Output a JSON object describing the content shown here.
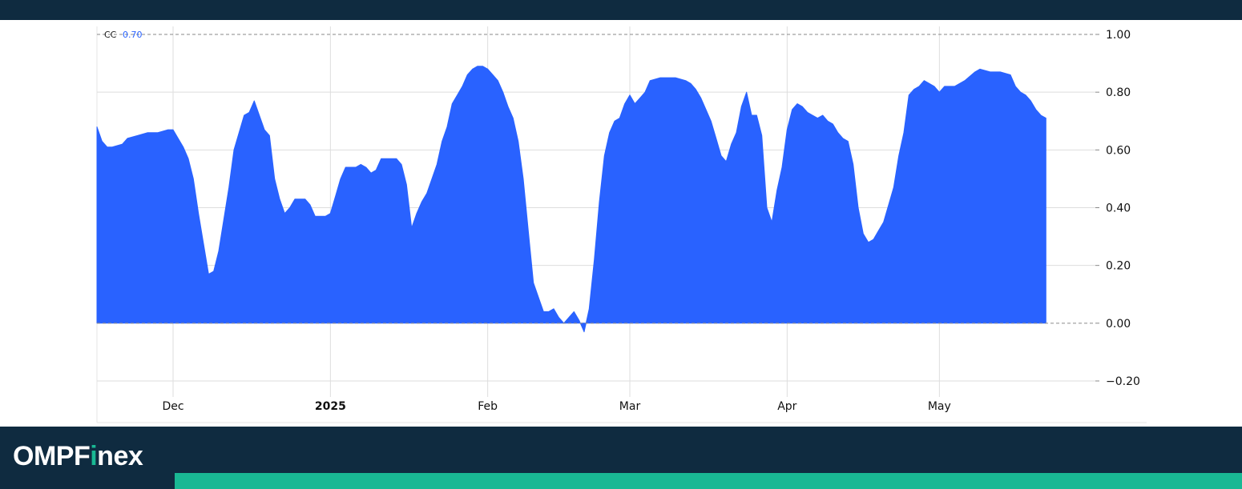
{
  "brand": {
    "logo_prefix": "OMPF",
    "logo_accent": "i",
    "logo_suffix": "nex",
    "accent_color": "#19b894",
    "bar_color": "#0f2b40"
  },
  "chart_data": {
    "type": "area",
    "series_label": "CC",
    "last_value_label": "0.70",
    "fill_color": "#2962ff",
    "ylim": [
      -0.2,
      1.0
    ],
    "y_ticks": [
      {
        "value": 1.0,
        "label": "1.00"
      },
      {
        "value": 0.8,
        "label": "0.80"
      },
      {
        "value": 0.6,
        "label": "0.60"
      },
      {
        "value": 0.4,
        "label": "0.40"
      },
      {
        "value": 0.2,
        "label": "0.20"
      },
      {
        "value": 0.0,
        "label": "0.00"
      },
      {
        "value": -0.2,
        "label": "−0.20"
      }
    ],
    "x_range": [
      "2024-11-16",
      "2025-05-30"
    ],
    "x_ticks": [
      {
        "date": "2024-12-01",
        "label": "Dec",
        "bold": false
      },
      {
        "date": "2025-01-01",
        "label": "2025",
        "bold": true
      },
      {
        "date": "2025-02-01",
        "label": "Feb",
        "bold": false
      },
      {
        "date": "2025-03-01",
        "label": "Mar",
        "bold": false
      },
      {
        "date": "2025-04-01",
        "label": "Apr",
        "bold": false
      },
      {
        "date": "2025-05-01",
        "label": "May",
        "bold": false
      }
    ],
    "grid": true,
    "points": [
      [
        "2024-11-16",
        0.68
      ],
      [
        "2024-11-17",
        0.63
      ],
      [
        "2024-11-18",
        0.61
      ],
      [
        "2024-11-19",
        0.61
      ],
      [
        "2024-11-21",
        0.62
      ],
      [
        "2024-11-22",
        0.64
      ],
      [
        "2024-11-24",
        0.65
      ],
      [
        "2024-11-26",
        0.66
      ],
      [
        "2024-11-28",
        0.66
      ],
      [
        "2024-11-30",
        0.67
      ],
      [
        "2024-12-01",
        0.67
      ],
      [
        "2024-12-02",
        0.64
      ],
      [
        "2024-12-03",
        0.61
      ],
      [
        "2024-12-04",
        0.57
      ],
      [
        "2024-12-05",
        0.5
      ],
      [
        "2024-12-06",
        0.38
      ],
      [
        "2024-12-08",
        0.17
      ],
      [
        "2024-12-09",
        0.18
      ],
      [
        "2024-12-10",
        0.25
      ],
      [
        "2024-12-12",
        0.47
      ],
      [
        "2024-12-13",
        0.6
      ],
      [
        "2024-12-15",
        0.72
      ],
      [
        "2024-12-16",
        0.73
      ],
      [
        "2024-12-17",
        0.77
      ],
      [
        "2024-12-19",
        0.67
      ],
      [
        "2024-12-20",
        0.65
      ],
      [
        "2024-12-21",
        0.5
      ],
      [
        "2024-12-22",
        0.43
      ],
      [
        "2024-12-23",
        0.38
      ],
      [
        "2024-12-24",
        0.4
      ],
      [
        "2024-12-25",
        0.43
      ],
      [
        "2024-12-27",
        0.43
      ],
      [
        "2024-12-28",
        0.41
      ],
      [
        "2024-12-29",
        0.37
      ],
      [
        "2024-12-31",
        0.37
      ],
      [
        "2025-01-01",
        0.38
      ],
      [
        "2025-01-02",
        0.44
      ],
      [
        "2025-01-03",
        0.5
      ],
      [
        "2025-01-04",
        0.54
      ],
      [
        "2025-01-06",
        0.54
      ],
      [
        "2025-01-07",
        0.55
      ],
      [
        "2025-01-08",
        0.54
      ],
      [
        "2025-01-09",
        0.52
      ],
      [
        "2025-01-10",
        0.53
      ],
      [
        "2025-01-11",
        0.57
      ],
      [
        "2025-01-12",
        0.57
      ],
      [
        "2025-01-14",
        0.57
      ],
      [
        "2025-01-15",
        0.55
      ],
      [
        "2025-01-16",
        0.48
      ],
      [
        "2025-01-17",
        0.33
      ],
      [
        "2025-01-18",
        0.38
      ],
      [
        "2025-01-19",
        0.42
      ],
      [
        "2025-01-20",
        0.45
      ],
      [
        "2025-01-22",
        0.55
      ],
      [
        "2025-01-23",
        0.63
      ],
      [
        "2025-01-24",
        0.68
      ],
      [
        "2025-01-25",
        0.76
      ],
      [
        "2025-01-26",
        0.79
      ],
      [
        "2025-01-27",
        0.82
      ],
      [
        "2025-01-28",
        0.86
      ],
      [
        "2025-01-29",
        0.88
      ],
      [
        "2025-01-30",
        0.89
      ],
      [
        "2025-01-31",
        0.89
      ],
      [
        "2025-02-01",
        0.88
      ],
      [
        "2025-02-02",
        0.86
      ],
      [
        "2025-02-03",
        0.84
      ],
      [
        "2025-02-04",
        0.8
      ],
      [
        "2025-02-05",
        0.75
      ],
      [
        "2025-02-06",
        0.71
      ],
      [
        "2025-02-07",
        0.63
      ],
      [
        "2025-02-08",
        0.5
      ],
      [
        "2025-02-09",
        0.32
      ],
      [
        "2025-02-10",
        0.14
      ],
      [
        "2025-02-11",
        0.09
      ],
      [
        "2025-02-12",
        0.04
      ],
      [
        "2025-02-13",
        0.04
      ],
      [
        "2025-02-14",
        0.05
      ],
      [
        "2025-02-15",
        0.02
      ],
      [
        "2025-02-16",
        0.0
      ],
      [
        "2025-02-17",
        0.02
      ],
      [
        "2025-02-18",
        0.04
      ],
      [
        "2025-02-19",
        0.01
      ],
      [
        "2025-02-20",
        -0.03
      ],
      [
        "2025-02-21",
        0.05
      ],
      [
        "2025-02-22",
        0.22
      ],
      [
        "2025-02-23",
        0.42
      ],
      [
        "2025-02-24",
        0.58
      ],
      [
        "2025-02-25",
        0.66
      ],
      [
        "2025-02-26",
        0.7
      ],
      [
        "2025-02-27",
        0.71
      ],
      [
        "2025-02-28",
        0.76
      ],
      [
        "2025-03-01",
        0.79
      ],
      [
        "2025-03-02",
        0.76
      ],
      [
        "2025-03-03",
        0.78
      ],
      [
        "2025-03-04",
        0.8
      ],
      [
        "2025-03-05",
        0.84
      ],
      [
        "2025-03-07",
        0.85
      ],
      [
        "2025-03-09",
        0.85
      ],
      [
        "2025-03-10",
        0.85
      ],
      [
        "2025-03-12",
        0.84
      ],
      [
        "2025-03-13",
        0.83
      ],
      [
        "2025-03-14",
        0.81
      ],
      [
        "2025-03-15",
        0.78
      ],
      [
        "2025-03-16",
        0.74
      ],
      [
        "2025-03-17",
        0.7
      ],
      [
        "2025-03-18",
        0.64
      ],
      [
        "2025-03-19",
        0.58
      ],
      [
        "2025-03-20",
        0.56
      ],
      [
        "2025-03-21",
        0.62
      ],
      [
        "2025-03-22",
        0.66
      ],
      [
        "2025-03-23",
        0.75
      ],
      [
        "2025-03-24",
        0.8
      ],
      [
        "2025-03-25",
        0.72
      ],
      [
        "2025-03-26",
        0.72
      ],
      [
        "2025-03-27",
        0.65
      ],
      [
        "2025-03-28",
        0.4
      ],
      [
        "2025-03-29",
        0.35
      ],
      [
        "2025-03-30",
        0.46
      ],
      [
        "2025-03-31",
        0.54
      ],
      [
        "2025-04-01",
        0.67
      ],
      [
        "2025-04-02",
        0.74
      ],
      [
        "2025-04-03",
        0.76
      ],
      [
        "2025-04-04",
        0.75
      ],
      [
        "2025-04-05",
        0.73
      ],
      [
        "2025-04-06",
        0.72
      ],
      [
        "2025-04-07",
        0.71
      ],
      [
        "2025-04-08",
        0.72
      ],
      [
        "2025-04-09",
        0.7
      ],
      [
        "2025-04-10",
        0.69
      ],
      [
        "2025-04-11",
        0.66
      ],
      [
        "2025-04-12",
        0.64
      ],
      [
        "2025-04-13",
        0.63
      ],
      [
        "2025-04-14",
        0.55
      ],
      [
        "2025-04-15",
        0.4
      ],
      [
        "2025-04-16",
        0.31
      ],
      [
        "2025-04-17",
        0.28
      ],
      [
        "2025-04-18",
        0.29
      ],
      [
        "2025-04-19",
        0.32
      ],
      [
        "2025-04-20",
        0.35
      ],
      [
        "2025-04-22",
        0.47
      ],
      [
        "2025-04-23",
        0.58
      ],
      [
        "2025-04-24",
        0.66
      ],
      [
        "2025-04-25",
        0.79
      ],
      [
        "2025-04-26",
        0.81
      ],
      [
        "2025-04-27",
        0.82
      ],
      [
        "2025-04-28",
        0.84
      ],
      [
        "2025-04-29",
        0.83
      ],
      [
        "2025-04-30",
        0.82
      ],
      [
        "2025-05-01",
        0.8
      ],
      [
        "2025-05-02",
        0.82
      ],
      [
        "2025-05-03",
        0.82
      ],
      [
        "2025-05-04",
        0.82
      ],
      [
        "2025-05-06",
        0.84
      ],
      [
        "2025-05-08",
        0.87
      ],
      [
        "2025-05-09",
        0.88
      ],
      [
        "2025-05-11",
        0.87
      ],
      [
        "2025-05-13",
        0.87
      ],
      [
        "2025-05-15",
        0.86
      ],
      [
        "2025-05-16",
        0.82
      ],
      [
        "2025-05-17",
        0.8
      ],
      [
        "2025-05-18",
        0.79
      ],
      [
        "2025-05-19",
        0.77
      ],
      [
        "2025-05-20",
        0.74
      ],
      [
        "2025-05-21",
        0.72
      ],
      [
        "2025-05-22",
        0.71
      ]
    ]
  }
}
